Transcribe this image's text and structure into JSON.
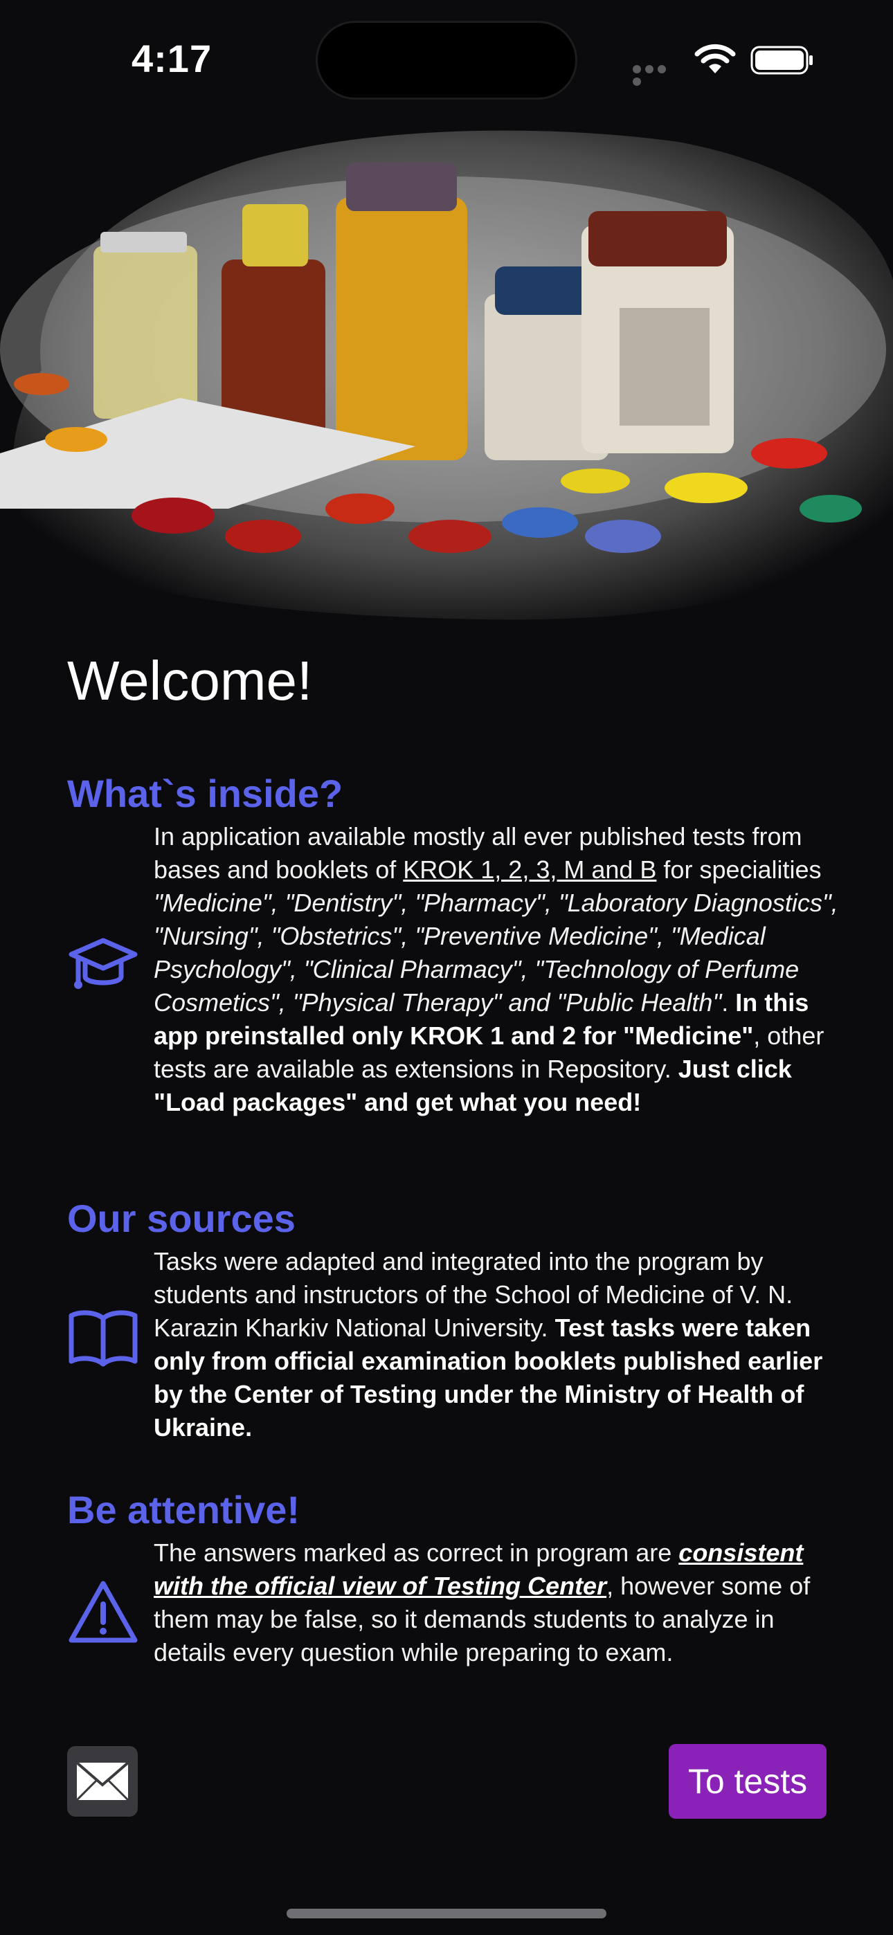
{
  "status": {
    "time": "4:17"
  },
  "welcome": "Welcome!",
  "sections": [
    {
      "title": "What`s inside?",
      "icon": "graduation-cap-icon",
      "t1": "In application available mostly all ever published tests from bases and booklets of ",
      "link": "KROK 1, 2, 3, M and B",
      "t2": " for specialities ",
      "specialities": "\"Medicine\", \"Dentistry\", \"Pharmacy\", \"Laboratory Diagnostics\", \"Nursing\", \"Obstetrics\", \"Preventive Medicine\", \"Medical Psychology\", \"Clinical Pharmacy\", \"Technology of Perfume Cosmetics\", \"Physical Therapy\" and \"Public Health\"",
      "t3": ". ",
      "b1": "In this app preinstalled only KROK 1 and 2 for \"Medicine\"",
      "t4": ", other tests are available as extensions in Repository. ",
      "b2": "Just click \"Load packages\" and get what you need!"
    },
    {
      "title": "Our sources",
      "icon": "book-icon",
      "t1": "Tasks were adapted and integrated into the program by students and instructors of the School of Medicine of V. N. Karazin Kharkiv National University. ",
      "b1": "Test tasks were taken only from official examination booklets published earlier by the Center of Testing under the Ministry of Health of Ukraine."
    },
    {
      "title": "Be attentive!",
      "icon": "warning-icon",
      "t1": "The answers marked as correct in program are ",
      "em": "consistent with the official view of Testing Center",
      "t2": ", however some of them may be false, so it demands students to analyze in details every question while preparing to exam."
    }
  ],
  "buttons": {
    "mail_icon": "mail-icon",
    "to_tests": "To tests"
  },
  "colors": {
    "accent": "#5b63ea",
    "button": "#8a22b8",
    "background": "#0b0b0d"
  }
}
